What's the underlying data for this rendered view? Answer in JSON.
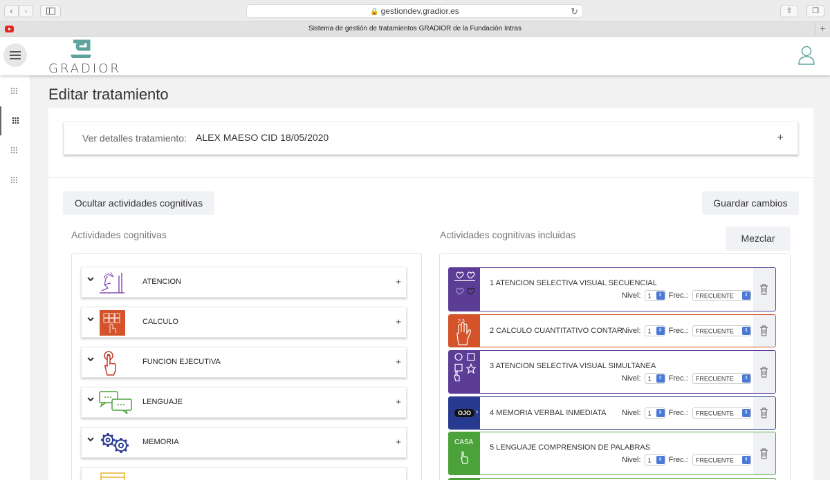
{
  "browser": {
    "url": "gestiondev.gradior.es",
    "tab_title": "Sistema de gestión de tratamientos GRADIOR de la Fundación Intras"
  },
  "header": {
    "logo_text": "GRADIOR"
  },
  "page": {
    "title": "Editar tratamiento",
    "details_label": "Ver detalles tratamiento:",
    "details_value": "ALEX MAESO CID 18/05/2020",
    "hide_button": "Ocultar actividades cognitivas",
    "save_button": "Guardar cambios",
    "mix_button": "Mezclar",
    "left_section": "Actividades cognitivas",
    "right_section": "Actividades cognitivas incluidas"
  },
  "categories": [
    {
      "label": "ATENCION",
      "icon": "attention-icon",
      "color": "#8e4fb4"
    },
    {
      "label": "CALCULO",
      "icon": "calculator-icon",
      "color": "#d4532b"
    },
    {
      "label": "FUNCION EJECUTIVA",
      "icon": "touch-hand-icon",
      "color": "#c0392b"
    },
    {
      "label": "LENGUAJE",
      "icon": "chat-bubbles-icon",
      "color": "#4ca23a"
    },
    {
      "label": "MEMORIA",
      "icon": "gears-icon",
      "color": "#283a8f"
    }
  ],
  "activities": [
    {
      "title": "1 ATENCION SELECTIVA VISUAL SECUENCIAL",
      "level": "1",
      "freq": "FRECUENTE",
      "color": "#5b3d96"
    },
    {
      "title": "2 CALCULO CUANTITATIVO CONTAR",
      "level": "1",
      "freq": "FRECUENTE",
      "color": "#d4532b"
    },
    {
      "title": "3 ATENCION SELECTIVA VISUAL SIMULTANEA",
      "level": "1",
      "freq": "FRECUENTE",
      "color": "#5b3d96"
    },
    {
      "title": "4 MEMORIA VERBAL INMEDIATA",
      "level": "1",
      "freq": "FRECUENTE",
      "color": "#283a8f"
    },
    {
      "title": "5 LENGUAJE COMPRENSION DE PALABRAS",
      "level": "1",
      "freq": "FRECUENTE",
      "color": "#4ca23a"
    }
  ],
  "labels": {
    "nivel": "Nivel:",
    "frec": "Frec.:",
    "casa": "CASA",
    "ojo": "OJO",
    "calc_digits": "2 3"
  }
}
